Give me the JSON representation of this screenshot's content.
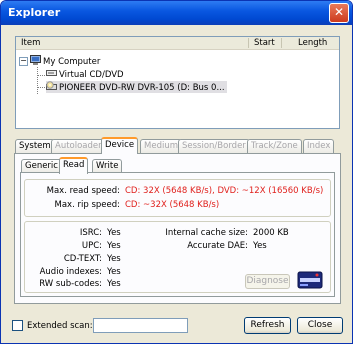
{
  "window": {
    "title": "Explorer",
    "close_glyph": "✕"
  },
  "tree": {
    "columns": [
      "Item",
      "Start",
      "Length"
    ],
    "expander_glyph": "−",
    "nodes": [
      {
        "label": "My Computer",
        "icon": "computer-icon"
      },
      {
        "label": "Virtual CD/DVD",
        "icon": "virtual-drive-icon"
      },
      {
        "label": "PIONEER DVD-RW  DVR-105 (D: Bus 0...",
        "icon": "cd-drive-icon",
        "selected": true
      }
    ]
  },
  "tabs": {
    "main": [
      {
        "label": "System",
        "enabled": true
      },
      {
        "label": "Autoloader",
        "enabled": false
      },
      {
        "label": "Device",
        "enabled": true,
        "active": true
      },
      {
        "label": "Medium",
        "enabled": false
      },
      {
        "label": "Session/Border",
        "enabled": false
      },
      {
        "label": "Track/Zone",
        "enabled": false
      },
      {
        "label": "Index",
        "enabled": false
      }
    ],
    "sub": [
      {
        "label": "Generic"
      },
      {
        "label": "Read",
        "active": true
      },
      {
        "label": "Write"
      }
    ]
  },
  "speeds": {
    "max_read_label": "Max. read speed:",
    "max_read_value": "CD: 32X (5648 KB/s), DVD: ~12X (16560 KB/s)",
    "max_rip_label": "Max. rip speed:",
    "max_rip_value": "CD: ~32X (5648 KB/s)"
  },
  "features": {
    "left": [
      {
        "label": "ISRC:",
        "value": "Yes"
      },
      {
        "label": "UPC:",
        "value": "Yes"
      },
      {
        "label": "CD-TEXT:",
        "value": "Yes"
      },
      {
        "label": "Audio indexes:",
        "value": "Yes"
      },
      {
        "label": "RW sub-codes:",
        "value": "Yes"
      }
    ],
    "right": [
      {
        "label": "Internal cache size:",
        "value": "2000 KB"
      },
      {
        "label": "Accurate DAE:",
        "value": "Yes"
      }
    ]
  },
  "buttons": {
    "diagnose": "Diagnose",
    "refresh": "Refresh",
    "close": "Close"
  },
  "footer": {
    "extended_scan_label": "Extended scan:",
    "extended_scan_checked": false,
    "extended_scan_value": ""
  },
  "colors": {
    "titlebar": "#0a58e1",
    "accent_tab": "#ff9a2a",
    "speed_value": "#e0201c"
  }
}
